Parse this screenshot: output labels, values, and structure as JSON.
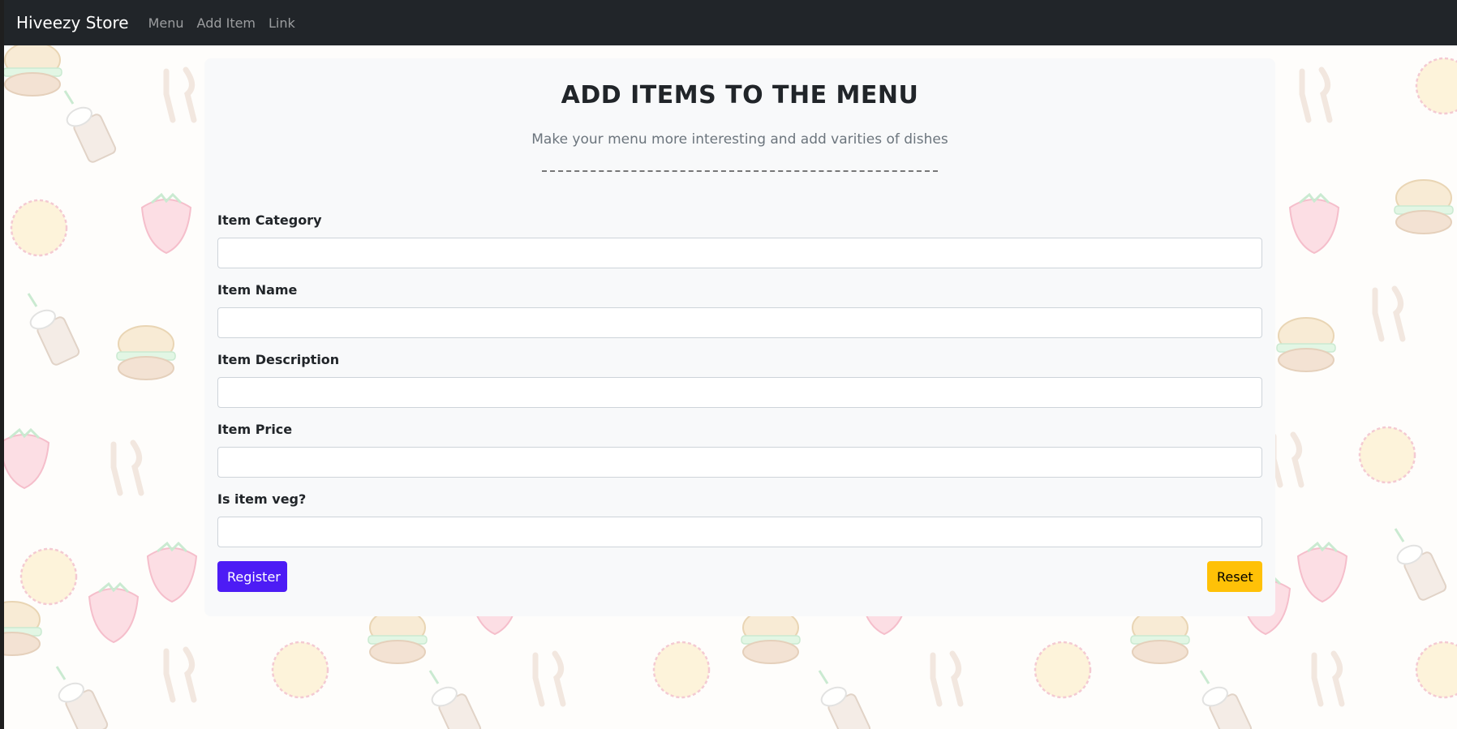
{
  "navbar": {
    "brand": "Hiveezy Store",
    "links": [
      "Menu",
      "Add Item",
      "Link"
    ]
  },
  "form": {
    "title": "ADD ITEMS TO THE MENU",
    "subtitle": "Make your menu more interesting and add varities of dishes",
    "fields": [
      {
        "label": "Item Category",
        "value": ""
      },
      {
        "label": "Item Name",
        "value": ""
      },
      {
        "label": "Item Description",
        "value": ""
      },
      {
        "label": "Item Price",
        "value": ""
      },
      {
        "label": "Is item veg?",
        "value": ""
      }
    ],
    "register_label": "Register",
    "reset_label": "Reset"
  },
  "colors": {
    "navbar": "#212529",
    "register": "#4d1cf5",
    "reset": "#ffc107",
    "card": "#f8f9fa"
  },
  "background": {
    "pattern_icons": [
      "burger-icon",
      "strawberry-icon",
      "cookie-icon",
      "milkshake-icon",
      "cutlery-icon"
    ]
  }
}
